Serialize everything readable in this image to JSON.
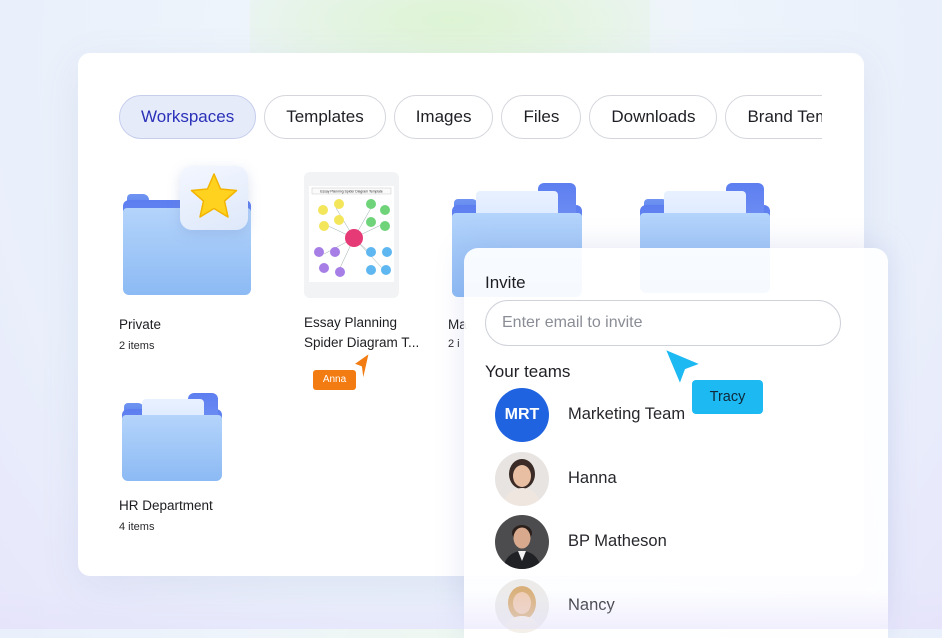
{
  "tabs": [
    {
      "label": "Workspaces",
      "active": true
    },
    {
      "label": "Templates",
      "active": false
    },
    {
      "label": "Images",
      "active": false
    },
    {
      "label": "Files",
      "active": false
    },
    {
      "label": "Downloads",
      "active": false
    },
    {
      "label": "Brand Templates",
      "active": false
    }
  ],
  "items": {
    "private": {
      "name": "Private",
      "count": "2 items",
      "badge_icon": "star-icon"
    },
    "essay": {
      "name_line1": "Essay Planning",
      "name_line2": "Spider Diagram T...",
      "thumb_title": "Essay Planning Spider Diagram Template"
    },
    "marketing": {
      "name": "Ma",
      "count": "2 i"
    },
    "hr": {
      "name": "HR Department",
      "count": "4 items"
    }
  },
  "cursors": {
    "anna": {
      "label": "Anna",
      "color": "#f27c12"
    },
    "tracy": {
      "label": "Tracy",
      "color": "#1cb9f2"
    }
  },
  "invite": {
    "label": "Invite",
    "placeholder": "Enter email to invite",
    "teams_title": "Your teams",
    "members": [
      {
        "name": "Marketing Team",
        "initials": "MRT"
      },
      {
        "name": "Hanna"
      },
      {
        "name": "BP Matheson"
      },
      {
        "name": "Nancy"
      }
    ]
  },
  "colors": {
    "accent": "#2a31b8",
    "active_tab_bg": "#e6ebfa",
    "folder_blue": "#8cbaf4",
    "team_avatar": "#1f63e0"
  }
}
